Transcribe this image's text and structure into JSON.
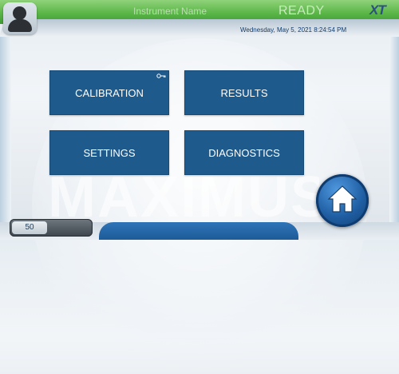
{
  "header": {
    "instrument_name": "Instrument Name",
    "status": "READY",
    "logo": "XT",
    "datetime": "Wednesday, May 5, 2021 8:24:54 PM"
  },
  "menu": {
    "tiles": [
      {
        "label": "CALIBRATION"
      },
      {
        "label": "RESULTS"
      },
      {
        "label": "SETTINGS"
      },
      {
        "label": "DIAGNOSTICS"
      }
    ]
  },
  "watermark": "MAXIMUS",
  "footer": {
    "counter_value": "50"
  },
  "icons": {
    "user": "user-icon",
    "key": "key-icon",
    "home": "home-icon"
  },
  "colors": {
    "tile": "#1e5a8c",
    "header_green": "#5bb648",
    "home_blue": "#1f5ea2"
  }
}
